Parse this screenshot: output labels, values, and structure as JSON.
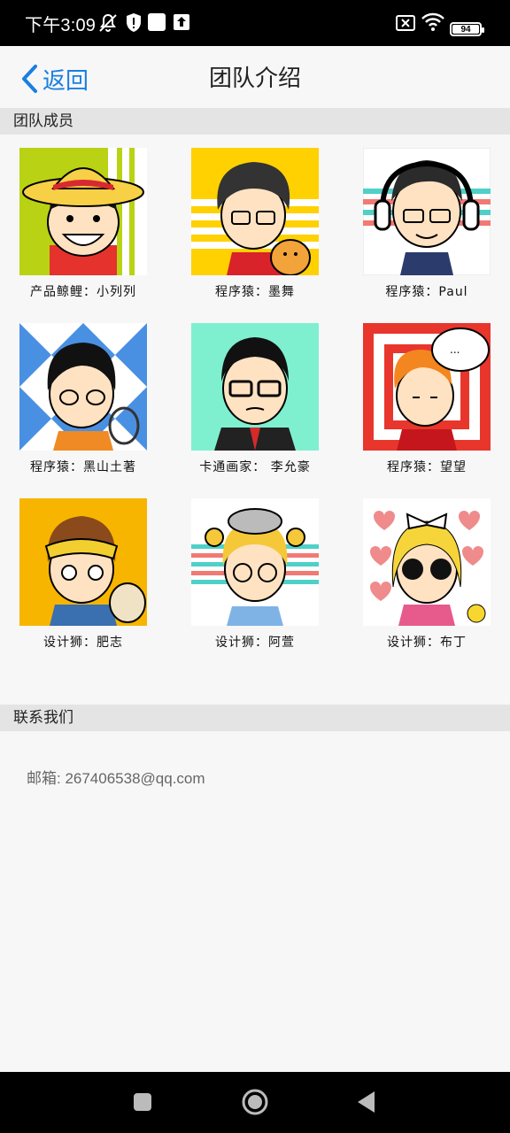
{
  "status": {
    "time": "下午3:09",
    "battery": "94"
  },
  "header": {
    "back_label": "返回",
    "title": "团队介绍"
  },
  "sections": {
    "members_title": "团队成员",
    "contact_title": "联系我们"
  },
  "members": [
    {
      "name": "产品鲸鲤：小列列",
      "avatar": "straw-hat-avatar"
    },
    {
      "name": "程序猿：墨舞",
      "avatar": "cat-hug-avatar"
    },
    {
      "name": "程序猿：Paul",
      "avatar": "headphones-avatar"
    },
    {
      "name": "程序猿：黑山土著",
      "avatar": "tennis-avatar"
    },
    {
      "name": "卡通画家： 李允豪",
      "avatar": "suit-avatar"
    },
    {
      "name": "程序猿：望望",
      "avatar": "speech-bubble-avatar"
    },
    {
      "name": "设计狮：肥志",
      "avatar": "mask-avatar"
    },
    {
      "name": "设计狮：阿萱",
      "avatar": "pigtails-avatar"
    },
    {
      "name": "设计狮：布丁",
      "avatar": "sunglasses-avatar"
    }
  ],
  "contact": {
    "email": "邮箱: 267406538@qq.com"
  },
  "colors": {
    "accent": "#1a7fe0",
    "section_bg": "#e4e4e4",
    "page_bg": "#f7f7f7"
  }
}
